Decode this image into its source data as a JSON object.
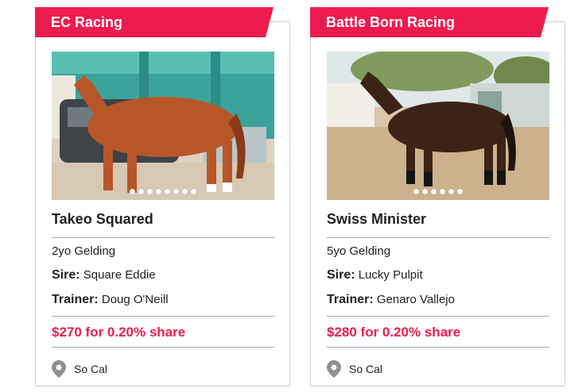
{
  "cards": [
    {
      "stable": "EC Racing",
      "horse": "Takeo Squared",
      "age_sex": "2yo Gelding",
      "sire_label": "Sire:",
      "sire": "Square Eddie",
      "trainer_label": "Trainer:",
      "trainer": "Doug O'Neill",
      "price": "$270 for 0.20% share",
      "location": "So Cal",
      "photo_count": 8,
      "active_photo": 0
    },
    {
      "stable": "Battle Born Racing",
      "horse": "Swiss Minister",
      "age_sex": "5yo Gelding",
      "sire_label": "Sire:",
      "sire": "Lucky Pulpit",
      "trainer_label": "Trainer:",
      "trainer": "Genaro Vallejo",
      "price": "$280 for 0.20% share",
      "location": "So Cal",
      "photo_count": 6,
      "active_photo": 0
    }
  ],
  "colors": {
    "accent": "#ee1c4e",
    "rule": "#a9a9a9",
    "border": "#cfcfcf"
  },
  "icons": {
    "location": "map-pin-icon"
  }
}
